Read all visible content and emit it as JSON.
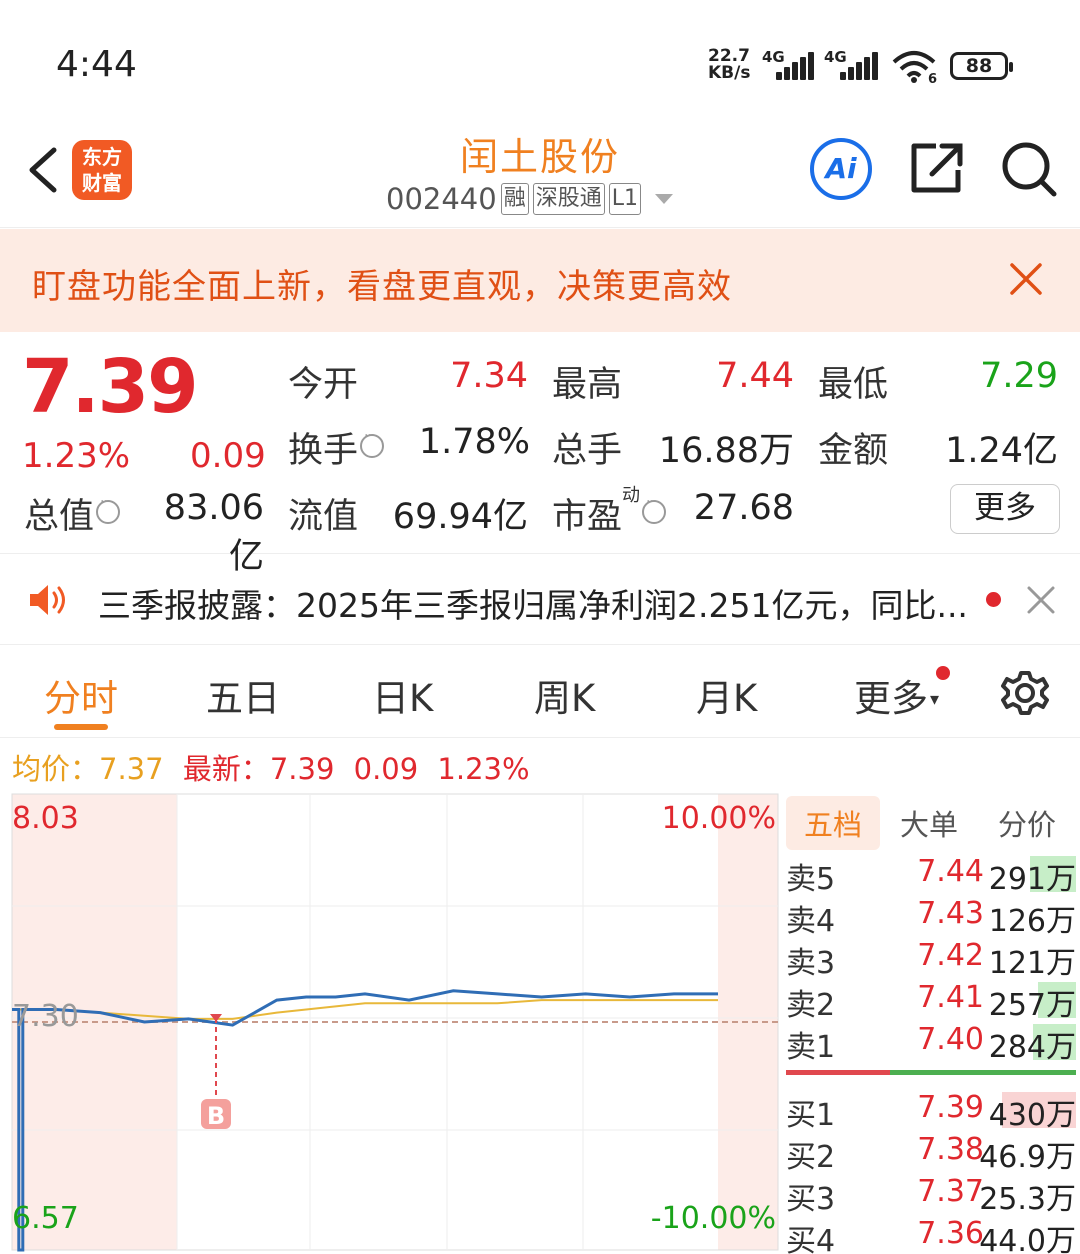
{
  "status_bar": {
    "time": "4:44",
    "net_speed_value": "22.7",
    "net_speed_unit": "KB/s",
    "signal1_label": "4G",
    "signal2_label": "4G",
    "wifi_label": "6",
    "battery": "88"
  },
  "header": {
    "logo_line1": "东方",
    "logo_line2": "财富",
    "stock_name": "闰土股份",
    "stock_code": "002440",
    "tag_margin": "融",
    "tag_connect": "深股通",
    "tag_level": "L1",
    "ai_label": "Ai",
    "icons": [
      "back-icon",
      "share-icon",
      "search-icon"
    ]
  },
  "banner": {
    "text": "盯盘功能全面上新，看盘更直观，决策更高效"
  },
  "quote": {
    "price": "7.39",
    "change_pct": "1.23%",
    "change_val": "0.09",
    "open_label": "今开",
    "open": "7.34",
    "high_label": "最高",
    "high": "7.44",
    "low_label": "最低",
    "low": "7.29",
    "turnover_label": "换手",
    "turnover": "1.78%",
    "volume_label": "总手",
    "volume": "16.88万",
    "amount_label": "金额",
    "amount": "1.24亿",
    "mktcap_label": "总值",
    "mktcap": "83.06亿",
    "float_label": "流值",
    "float": "69.94亿",
    "pe_label": "市盈",
    "pe_sup": "动",
    "pe": "27.68",
    "more": "更多"
  },
  "news": {
    "text": "三季报披露：2025年三季报归属净利润2.251亿元，同比..."
  },
  "tabs": {
    "items": [
      "分时",
      "五日",
      "日K",
      "周K",
      "月K",
      "更多"
    ],
    "active": 0
  },
  "chart_stats": {
    "avg_label": "均价：",
    "avg": "7.37",
    "latest_label": "最新：",
    "latest": "7.39",
    "change": "0.09",
    "change_pct": "1.23%"
  },
  "chart_data": {
    "type": "line",
    "y_left_top": "8.03",
    "y_left_bottom": "6.57",
    "y_left_mid": "7.30",
    "y_right_top": "10.00%",
    "y_right_bottom": "-10.00%",
    "ylim": [
      6.57,
      8.03
    ],
    "prev_close": 7.3,
    "marker_label": "B",
    "x": [
      0,
      3,
      5,
      15,
      30,
      45,
      60,
      75,
      90,
      100,
      110,
      120,
      135,
      150,
      165,
      180,
      195,
      210,
      225,
      240
    ],
    "series": [
      {
        "values": [
          7.34,
          7.34,
          7.34,
          7.34,
          7.33,
          7.3,
          7.31,
          7.29,
          7.37,
          7.38,
          7.38,
          7.39,
          7.37,
          7.4,
          7.39,
          7.38,
          7.39,
          7.38,
          7.39,
          7.39
        ]
      },
      {
        "values": [
          7.34,
          7.34,
          7.34,
          7.34,
          7.33,
          7.32,
          7.31,
          7.31,
          7.33,
          7.34,
          7.35,
          7.36,
          7.36,
          7.36,
          7.36,
          7.37,
          7.37,
          7.37,
          7.37,
          7.37
        ]
      }
    ],
    "colors": {
      "price": "#2f6db5",
      "avg": "#e8b83a",
      "prev_close": "#c89a8a"
    }
  },
  "orderbook": {
    "tabs": [
      "五档",
      "大单",
      "分价"
    ],
    "sell": [
      {
        "label": "卖5",
        "price": "7.44",
        "vol": "291万",
        "ratio": 0.54
      },
      {
        "label": "卖4",
        "price": "7.43",
        "vol": "126万",
        "ratio": 0.0
      },
      {
        "label": "卖3",
        "price": "7.42",
        "vol": "121万",
        "ratio": 0.0
      },
      {
        "label": "卖2",
        "price": "7.41",
        "vol": "257万",
        "ratio": 0.44
      },
      {
        "label": "卖1",
        "price": "7.40",
        "vol": "284万",
        "ratio": 0.5
      }
    ],
    "buy": [
      {
        "label": "买1",
        "price": "7.39",
        "vol": "430万",
        "ratio": 0.86
      },
      {
        "label": "买2",
        "price": "7.38",
        "vol": "46.9万",
        "ratio": 0
      },
      {
        "label": "买3",
        "price": "7.37",
        "vol": "25.3万",
        "ratio": 0
      },
      {
        "label": "买4",
        "price": "7.36",
        "vol": "44.0万",
        "ratio": 0
      }
    ],
    "colors": {
      "up": "#e0282e",
      "sell_bar": "#c7eec8",
      "buy_bar": "#f9d4d4"
    }
  }
}
